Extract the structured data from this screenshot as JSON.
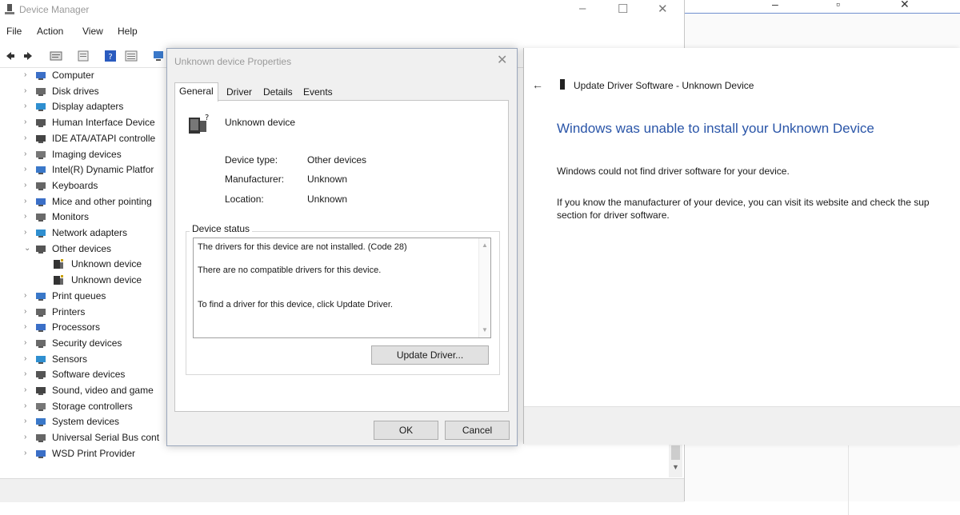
{
  "device_manager": {
    "title": "Device Manager",
    "menu": [
      "File",
      "Action",
      "View",
      "Help"
    ],
    "tree": [
      {
        "label": "Computer",
        "expanded": false,
        "icon": "computer-icon"
      },
      {
        "label": "Disk drives",
        "expanded": false,
        "icon": "disk-drive-icon"
      },
      {
        "label": "Display adapters",
        "expanded": false,
        "icon": "display-adapter-icon"
      },
      {
        "label": "Human Interface Device",
        "expanded": false,
        "icon": "hid-icon"
      },
      {
        "label": "IDE ATA/ATAPI controlle",
        "expanded": false,
        "icon": "ide-controller-icon"
      },
      {
        "label": "Imaging devices",
        "expanded": false,
        "icon": "camera-icon"
      },
      {
        "label": "Intel(R) Dynamic Platfor",
        "expanded": false,
        "icon": "intel-platform-icon"
      },
      {
        "label": "Keyboards",
        "expanded": false,
        "icon": "keyboard-icon"
      },
      {
        "label": "Mice and other pointing",
        "expanded": false,
        "icon": "mouse-icon"
      },
      {
        "label": "Monitors",
        "expanded": false,
        "icon": "monitor-icon"
      },
      {
        "label": "Network adapters",
        "expanded": false,
        "icon": "network-adapter-icon"
      },
      {
        "label": "Other devices",
        "expanded": true,
        "icon": "other-devices-icon"
      },
      {
        "label": "Unknown device",
        "child": true,
        "icon": "unknown-device-icon"
      },
      {
        "label": "Unknown device",
        "child": true,
        "icon": "unknown-device-icon"
      },
      {
        "label": "Print queues",
        "expanded": false,
        "icon": "printer-icon"
      },
      {
        "label": "Printers",
        "expanded": false,
        "icon": "printer-icon"
      },
      {
        "label": "Processors",
        "expanded": false,
        "icon": "processor-icon"
      },
      {
        "label": "Security devices",
        "expanded": false,
        "icon": "security-device-icon"
      },
      {
        "label": "Sensors",
        "expanded": false,
        "icon": "sensor-icon"
      },
      {
        "label": "Software devices",
        "expanded": false,
        "icon": "software-device-icon"
      },
      {
        "label": "Sound, video and game",
        "expanded": false,
        "icon": "speaker-icon"
      },
      {
        "label": "Storage controllers",
        "expanded": false,
        "icon": "storage-controller-icon"
      },
      {
        "label": "System devices",
        "expanded": false,
        "icon": "system-device-icon"
      },
      {
        "label": "Universal Serial Bus cont",
        "expanded": false,
        "icon": "usb-icon"
      },
      {
        "label": "WSD Print Provider",
        "expanded": false,
        "icon": "printer-icon"
      }
    ]
  },
  "properties": {
    "title": "Unknown device Properties",
    "tabs": [
      "General",
      "Driver",
      "Details",
      "Events"
    ],
    "device_name": "Unknown device",
    "fields": [
      {
        "key": "Device type:",
        "value": "Other devices"
      },
      {
        "key": "Manufacturer:",
        "value": "Unknown"
      },
      {
        "key": "Location:",
        "value": "Unknown"
      }
    ],
    "status_label": "Device status",
    "status_lines": [
      "The drivers for this device are not installed. (Code 28)",
      "There are no compatible drivers for this device.",
      "To find a driver for this device, click Update Driver."
    ],
    "update_button": "Update Driver...",
    "ok_button": "OK",
    "cancel_button": "Cancel"
  },
  "update_driver": {
    "title": "Update Driver Software - Unknown Device",
    "heading": "Windows was unable to install your Unknown Device",
    "line1": "Windows could not find driver software for your device.",
    "line2": "If you know the manufacturer of your device, you can visit its website and check the sup",
    "line3": "section for driver software."
  },
  "colors": {
    "heading_blue": "#2a55a8",
    "dialog_bg": "#f0f0f0"
  }
}
